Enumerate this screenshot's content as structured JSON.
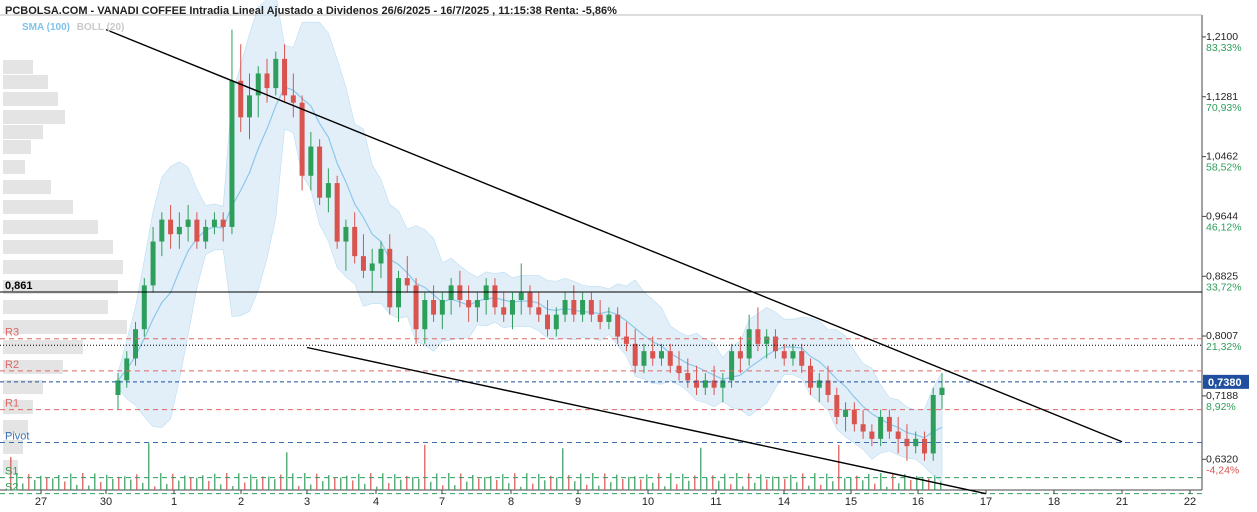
{
  "title": "PCBOLSA.COM - VANADI COFFEE Intradia Lineal Ajustado a Dividenos 26/6/2025 - 16/7/2025 , 11:15:38 Renta: -5,86%",
  "indicators": {
    "sma": "SMA (100)",
    "boll": "BOLL (20)"
  },
  "colors": {
    "up": "#2e9e5b",
    "down": "#d9534f",
    "sma": "#8cc8ea",
    "band": "#cfe6f6",
    "axis_price": "#222222",
    "axis_pct_pos": "#2e9e5b",
    "axis_pct_neg": "#d9534f",
    "resistance": "#e06666",
    "pivot": "#3a6fb0",
    "support": "#2e9e5b",
    "current_bg": "#1f4f9e",
    "volume_profile": "#d9d9d9"
  },
  "chart_data": {
    "type": "line",
    "subtype": "candlestick",
    "series": [
      {
        "name": "SMA (100)"
      },
      {
        "name": "BOLL (20)"
      }
    ],
    "ylim": [
      0.59,
      1.24
    ],
    "x_ticks": [
      "27",
      "30",
      "1",
      "2",
      "3",
      "4",
      "7",
      "8",
      "9",
      "10",
      "11",
      "14",
      "15",
      "16",
      "17",
      "18",
      "21",
      "22"
    ],
    "y_ticks": [
      {
        "price": "1,2100",
        "pct": "83,33%",
        "v": 1.21
      },
      {
        "price": "1,1281",
        "pct": "70,93%",
        "v": 1.1281
      },
      {
        "price": "1,0462",
        "pct": "58,52%",
        "v": 1.0462
      },
      {
        "price": "0,9644",
        "pct": "46,12%",
        "v": 0.9644
      },
      {
        "price": "0,8825",
        "pct": "33,72%",
        "v": 0.8825
      },
      {
        "price": "0,8007",
        "pct": "21,32%",
        "v": 0.8007
      },
      {
        "price": "0,7188",
        "pct": "8,92%",
        "v": 0.7188
      },
      {
        "price": "0,6320",
        "pct": "-4,24%",
        "v": 0.632
      }
    ],
    "current_price": {
      "label": "0,7380",
      "v": 0.738
    },
    "levels": [
      {
        "label": "0,861",
        "v": 0.861,
        "kind": "horizontal"
      },
      {
        "label": "R3",
        "v": 0.797,
        "kind": "resistance"
      },
      {
        "label": "R2",
        "v": 0.753,
        "kind": "resistance"
      },
      {
        "label": "",
        "v": 0.788,
        "kind": "dotted"
      },
      {
        "label": "R1",
        "v": 0.7,
        "kind": "resistance"
      },
      {
        "label": "Pivot",
        "v": 0.655,
        "kind": "pivot"
      },
      {
        "label": "S1",
        "v": 0.607,
        "kind": "support"
      },
      {
        "label": "S2",
        "v": 0.585,
        "kind": "support"
      }
    ],
    "trendlines": [
      {
        "from": [
          "30",
          1.22
        ],
        "to": [
          "21",
          0.656
        ]
      },
      {
        "from": [
          "3",
          0.785
        ],
        "to": [
          "17",
          0.585
        ]
      }
    ],
    "candles": [
      [
        0.72,
        0.75,
        0.7,
        0.74
      ],
      [
        0.74,
        0.78,
        0.73,
        0.77
      ],
      [
        0.77,
        0.82,
        0.76,
        0.81
      ],
      [
        0.81,
        0.88,
        0.8,
        0.87
      ],
      [
        0.87,
        0.95,
        0.86,
        0.93
      ],
      [
        0.93,
        0.97,
        0.91,
        0.96
      ],
      [
        0.96,
        0.98,
        0.92,
        0.94
      ],
      [
        0.94,
        0.97,
        0.92,
        0.95
      ],
      [
        0.95,
        0.98,
        0.93,
        0.96
      ],
      [
        0.96,
        0.97,
        0.92,
        0.93
      ],
      [
        0.93,
        0.96,
        0.92,
        0.95
      ],
      [
        0.95,
        0.97,
        0.94,
        0.96
      ],
      [
        0.96,
        0.97,
        0.93,
        0.95
      ],
      [
        0.95,
        1.22,
        0.94,
        1.15
      ],
      [
        1.15,
        1.2,
        1.08,
        1.1
      ],
      [
        1.1,
        1.16,
        1.07,
        1.13
      ],
      [
        1.13,
        1.17,
        1.1,
        1.16
      ],
      [
        1.16,
        1.18,
        1.12,
        1.14
      ],
      [
        1.14,
        1.19,
        1.13,
        1.18
      ],
      [
        1.18,
        1.2,
        1.12,
        1.13
      ],
      [
        1.13,
        1.16,
        1.1,
        1.12
      ],
      [
        1.12,
        1.13,
        1.0,
        1.02
      ],
      [
        1.02,
        1.08,
        1.0,
        1.06
      ],
      [
        1.06,
        1.07,
        0.98,
        0.99
      ],
      [
        0.99,
        1.03,
        0.97,
        1.01
      ],
      [
        1.01,
        1.02,
        0.92,
        0.93
      ],
      [
        0.93,
        0.96,
        0.89,
        0.95
      ],
      [
        0.95,
        0.97,
        0.9,
        0.91
      ],
      [
        0.91,
        0.94,
        0.88,
        0.89
      ],
      [
        0.89,
        0.92,
        0.86,
        0.9
      ],
      [
        0.9,
        0.93,
        0.88,
        0.92
      ],
      [
        0.92,
        0.94,
        0.83,
        0.84
      ],
      [
        0.84,
        0.89,
        0.82,
        0.88
      ],
      [
        0.88,
        0.91,
        0.86,
        0.87
      ],
      [
        0.87,
        0.88,
        0.79,
        0.81
      ],
      [
        0.81,
        0.86,
        0.79,
        0.85
      ],
      [
        0.85,
        0.87,
        0.82,
        0.83
      ],
      [
        0.83,
        0.86,
        0.81,
        0.85
      ],
      [
        0.85,
        0.88,
        0.83,
        0.87
      ],
      [
        0.87,
        0.89,
        0.84,
        0.85
      ],
      [
        0.85,
        0.87,
        0.82,
        0.84
      ],
      [
        0.84,
        0.86,
        0.82,
        0.85
      ],
      [
        0.85,
        0.88,
        0.83,
        0.87
      ],
      [
        0.87,
        0.88,
        0.83,
        0.84
      ],
      [
        0.84,
        0.86,
        0.82,
        0.83
      ],
      [
        0.83,
        0.86,
        0.81,
        0.85
      ],
      [
        0.85,
        0.9,
        0.83,
        0.86
      ],
      [
        0.86,
        0.87,
        0.83,
        0.84
      ],
      [
        0.84,
        0.86,
        0.82,
        0.83
      ],
      [
        0.83,
        0.85,
        0.8,
        0.81
      ],
      [
        0.81,
        0.84,
        0.8,
        0.83
      ],
      [
        0.83,
        0.86,
        0.82,
        0.85
      ],
      [
        0.85,
        0.87,
        0.82,
        0.83
      ],
      [
        0.83,
        0.86,
        0.82,
        0.85
      ],
      [
        0.85,
        0.86,
        0.82,
        0.83
      ],
      [
        0.83,
        0.85,
        0.81,
        0.82
      ],
      [
        0.82,
        0.84,
        0.81,
        0.83
      ],
      [
        0.83,
        0.84,
        0.79,
        0.8
      ],
      [
        0.8,
        0.82,
        0.78,
        0.79
      ],
      [
        0.79,
        0.81,
        0.75,
        0.76
      ],
      [
        0.76,
        0.79,
        0.75,
        0.78
      ],
      [
        0.78,
        0.8,
        0.76,
        0.77
      ],
      [
        0.77,
        0.79,
        0.76,
        0.78
      ],
      [
        0.78,
        0.79,
        0.75,
        0.76
      ],
      [
        0.76,
        0.78,
        0.74,
        0.75
      ],
      [
        0.75,
        0.77,
        0.73,
        0.74
      ],
      [
        0.74,
        0.76,
        0.72,
        0.73
      ],
      [
        0.73,
        0.75,
        0.72,
        0.74
      ],
      [
        0.74,
        0.76,
        0.72,
        0.73
      ],
      [
        0.73,
        0.75,
        0.71,
        0.74
      ],
      [
        0.74,
        0.79,
        0.73,
        0.78
      ],
      [
        0.78,
        0.8,
        0.75,
        0.77
      ],
      [
        0.77,
        0.83,
        0.76,
        0.81
      ],
      [
        0.81,
        0.84,
        0.78,
        0.79
      ],
      [
        0.79,
        0.81,
        0.77,
        0.8
      ],
      [
        0.8,
        0.81,
        0.77,
        0.78
      ],
      [
        0.78,
        0.79,
        0.76,
        0.77
      ],
      [
        0.77,
        0.79,
        0.76,
        0.78
      ],
      [
        0.78,
        0.79,
        0.75,
        0.76
      ],
      [
        0.76,
        0.77,
        0.72,
        0.73
      ],
      [
        0.73,
        0.75,
        0.71,
        0.74
      ],
      [
        0.74,
        0.76,
        0.71,
        0.72
      ],
      [
        0.72,
        0.73,
        0.68,
        0.69
      ],
      [
        0.69,
        0.71,
        0.67,
        0.7
      ],
      [
        0.7,
        0.71,
        0.67,
        0.68
      ],
      [
        0.68,
        0.7,
        0.66,
        0.67
      ],
      [
        0.67,
        0.68,
        0.65,
        0.66
      ],
      [
        0.66,
        0.7,
        0.65,
        0.69
      ],
      [
        0.69,
        0.7,
        0.66,
        0.67
      ],
      [
        0.67,
        0.69,
        0.64,
        0.66
      ],
      [
        0.66,
        0.68,
        0.63,
        0.65
      ],
      [
        0.65,
        0.67,
        0.64,
        0.66
      ],
      [
        0.66,
        0.67,
        0.63,
        0.64
      ],
      [
        0.64,
        0.73,
        0.63,
        0.72
      ],
      [
        0.72,
        0.75,
        0.7,
        0.73
      ]
    ]
  }
}
